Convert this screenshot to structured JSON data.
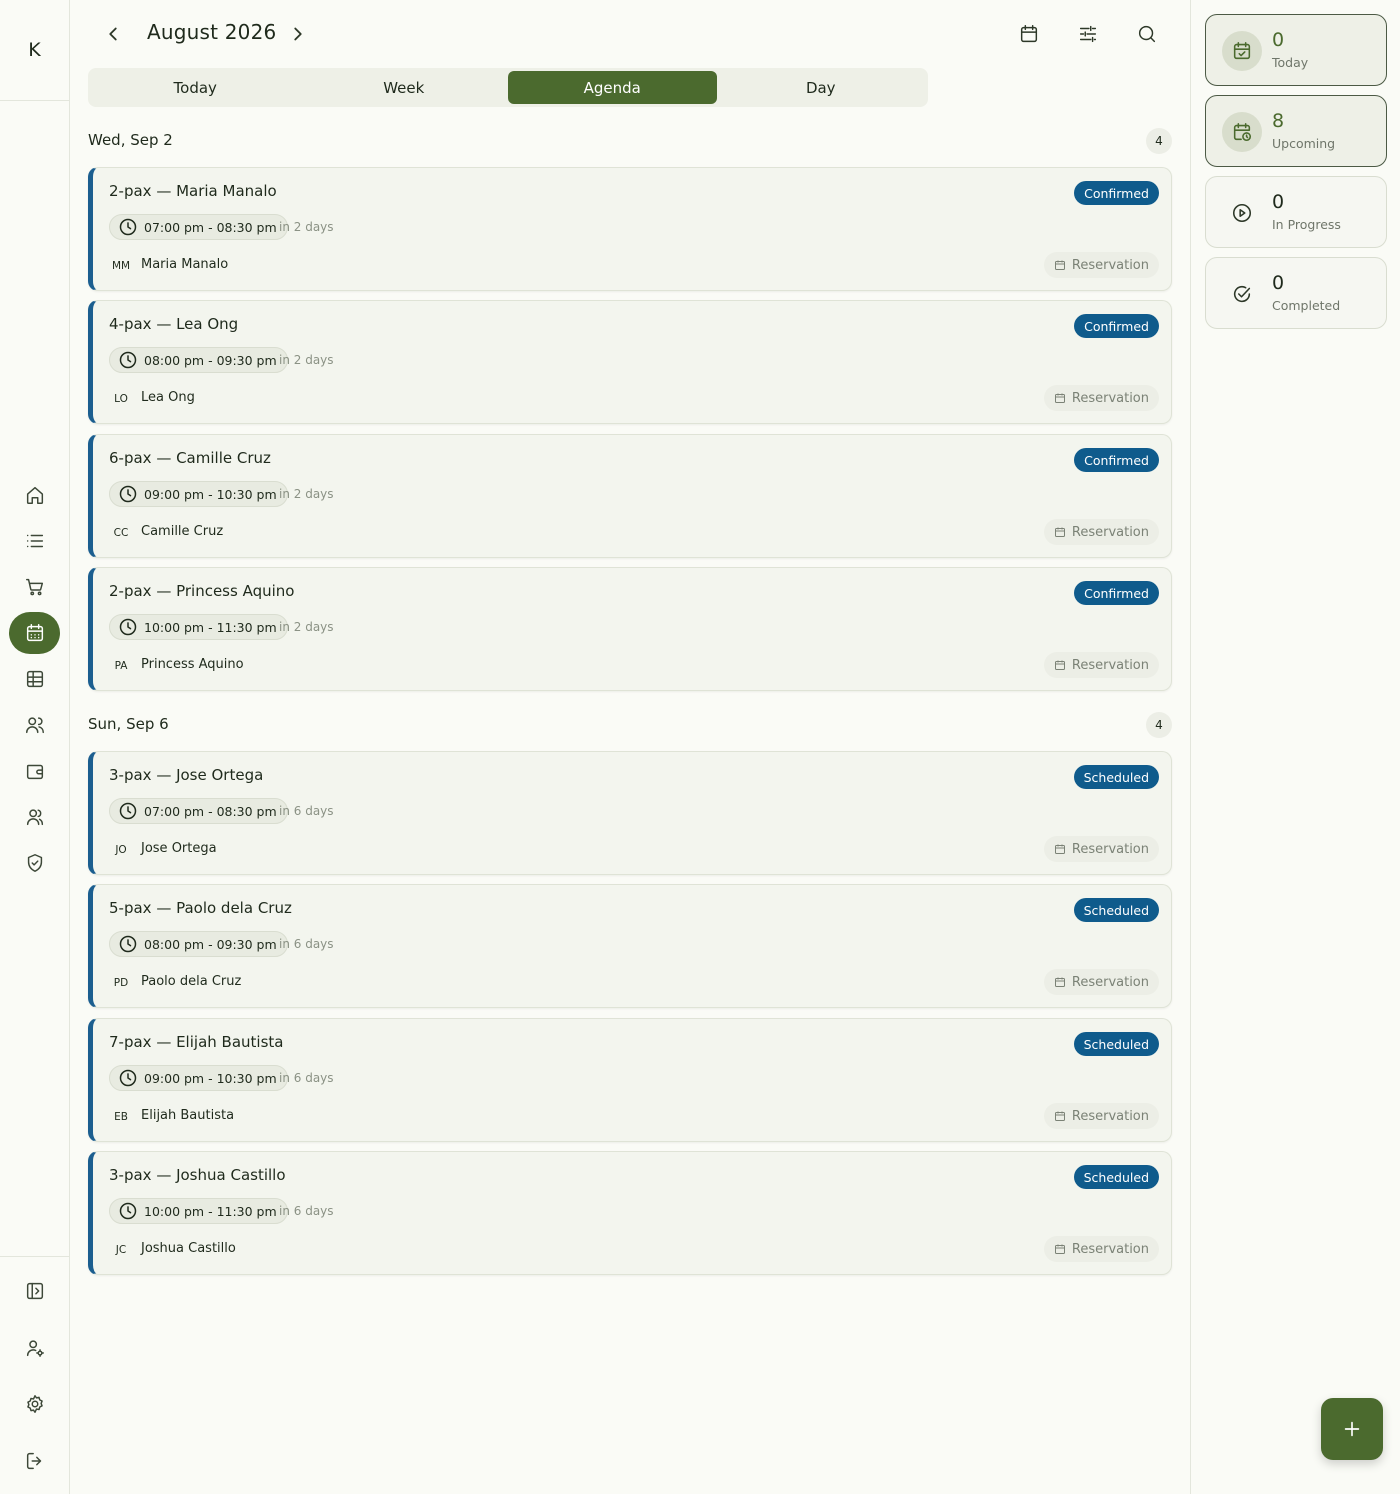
{
  "app": {
    "logo": "K"
  },
  "header": {
    "month": "August 2026",
    "tabs": [
      {
        "label": "Today"
      },
      {
        "label": "Week"
      },
      {
        "label": "Agenda",
        "active": true
      },
      {
        "label": "Day"
      }
    ]
  },
  "groups": [
    {
      "date": "Wed, Sep 2",
      "count": "4",
      "items": [
        {
          "title": "2-pax — Maria Manalo",
          "status": "Confirmed",
          "time": "07:00 pm - 08:30 pm",
          "relative": "in 2 days",
          "initials": "MM",
          "guest": "Maria Manalo",
          "kind": "Reservation"
        },
        {
          "title": "4-pax — Lea Ong",
          "status": "Confirmed",
          "time": "08:00 pm - 09:30 pm",
          "relative": "in 2 days",
          "initials": "LO",
          "guest": "Lea Ong",
          "kind": "Reservation"
        },
        {
          "title": "6-pax — Camille Cruz",
          "status": "Confirmed",
          "time": "09:00 pm - 10:30 pm",
          "relative": "in 2 days",
          "initials": "CC",
          "guest": "Camille Cruz",
          "kind": "Reservation"
        },
        {
          "title": "2-pax — Princess Aquino",
          "status": "Confirmed",
          "time": "10:00 pm - 11:30 pm",
          "relative": "in 2 days",
          "initials": "PA",
          "guest": "Princess Aquino",
          "kind": "Reservation"
        }
      ]
    },
    {
      "date": "Sun, Sep 6",
      "count": "4",
      "items": [
        {
          "title": "3-pax — Jose Ortega",
          "status": "Scheduled",
          "time": "07:00 pm - 08:30 pm",
          "relative": "in 6 days",
          "initials": "JO",
          "guest": "Jose Ortega",
          "kind": "Reservation"
        },
        {
          "title": "5-pax — Paolo dela Cruz",
          "status": "Scheduled",
          "time": "08:00 pm - 09:30 pm",
          "relative": "in 6 days",
          "initials": "PD",
          "guest": "Paolo dela Cruz",
          "kind": "Reservation"
        },
        {
          "title": "7-pax — Elijah Bautista",
          "status": "Scheduled",
          "time": "09:00 pm - 10:30 pm",
          "relative": "in 6 days",
          "initials": "EB",
          "guest": "Elijah Bautista",
          "kind": "Reservation"
        },
        {
          "title": "3-pax — Joshua Castillo",
          "status": "Scheduled",
          "time": "10:00 pm - 11:30 pm",
          "relative": "in 6 days",
          "initials": "JC",
          "guest": "Joshua Castillo",
          "kind": "Reservation"
        }
      ]
    }
  ],
  "stats": [
    {
      "value": "0",
      "label": "Today",
      "icon": "calendar-check-icon"
    },
    {
      "value": "8",
      "label": "Upcoming",
      "icon": "calendar-clock-icon"
    },
    {
      "value": "0",
      "label": "In Progress",
      "icon": "play-circle-icon"
    },
    {
      "value": "0",
      "label": "Completed",
      "icon": "check-circle-icon"
    }
  ],
  "colors": {
    "accent": "#4b6a2e",
    "status": "#0f5b8c",
    "card_border_left": "#1b5e8f"
  }
}
